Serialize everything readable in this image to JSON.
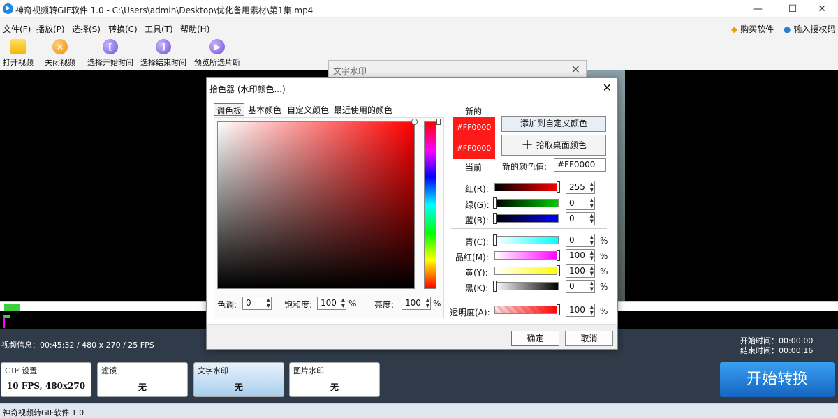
{
  "window": {
    "title": "神奇视频转GIF软件 1.0 - C:\\Users\\admin\\Desktop\\优化备用素材\\第1集.mp4",
    "min": "—",
    "max": "☐",
    "close": "✕",
    "app_icon": "▶"
  },
  "menu": {
    "items": [
      "文件(F)",
      "播放(P)",
      "选择(S)",
      "转换(C)",
      "工具(T)",
      "帮助(H)"
    ],
    "buy": "购买软件",
    "license": "输入授权码"
  },
  "toolbar": {
    "buttons": [
      "打开视频",
      "关闭视频",
      "选择开始时间",
      "选择结束时间",
      "预览所选片断"
    ]
  },
  "info": {
    "video": "视频信息：00:45:32 / 480 x 270 / 25 FPS",
    "start": "开始时间：00:00:00",
    "end": "结束时间：00:00:16"
  },
  "panels": {
    "gif": {
      "title": "GIF 设置",
      "value": "10 FPS, 480x270"
    },
    "filter": {
      "title": "滤镜",
      "value": "无"
    },
    "text": {
      "title": "文字水印",
      "value": "无"
    },
    "image": {
      "title": "图片水印",
      "value": "无"
    },
    "start": "开始转换"
  },
  "statusbar": "神奇视频转GIF软件 1.0",
  "watermark_dialog": {
    "title": "文字水印",
    "close": "✕"
  },
  "picker": {
    "title": "拾色器 (水印颜色...)",
    "close": "✕",
    "tabs": [
      "调色板",
      "基本颜色",
      "自定义颜色",
      "最近使用的颜色"
    ],
    "new_label": "新的",
    "current_label": "当前",
    "new_hex": "#FF0000",
    "current_hex": "#FF0000",
    "add_custom": "添加到自定义颜色",
    "pick_desktop": "拾取桌面颜色",
    "new_value_label": "新的颜色值:",
    "new_value": "#FF0000",
    "hue_label": "色调:",
    "hue": "0",
    "sat_label": "饱和度:",
    "sat": "100",
    "bri_label": "亮度:",
    "bri": "100",
    "pct": "%",
    "r_label": "红(R):",
    "r": "255",
    "g_label": "绿(G):",
    "g": "0",
    "b_label": "蓝(B):",
    "b": "0",
    "c_label": "青(C):",
    "c": "0",
    "m_label": "品红(M):",
    "m": "100",
    "y_label": "黄(Y):",
    "y": "100",
    "k_label": "黑(K):",
    "k": "0",
    "alpha_label": "透明度(A):",
    "alpha": "100",
    "ok": "确定",
    "cancel": "取消"
  }
}
